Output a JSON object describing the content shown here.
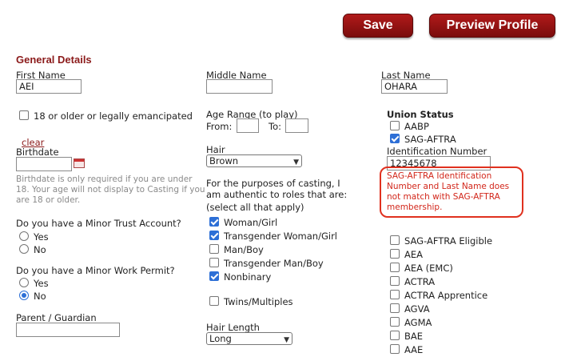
{
  "toolbar": {
    "save_label": "Save",
    "preview_label": "Preview Profile"
  },
  "section_title": "General Details",
  "first_name": {
    "label": "First Name",
    "value": "AEI"
  },
  "middle_name": {
    "label": "Middle Name",
    "value": ""
  },
  "last_name": {
    "label": "Last Name",
    "value": "OHARA"
  },
  "emancipated": {
    "label": "18 or older or legally emancipated",
    "checked": false
  },
  "clear_link": "clear",
  "birthdate": {
    "label": "Birthdate",
    "value": "",
    "note": [
      "Birthdate is only required if you are under",
      "18. Your age will not display to Casting if you",
      "are 18 or older."
    ]
  },
  "age_range": {
    "label": "Age Range (to play)",
    "from_label": "From:",
    "to_label": "To:",
    "from_value": "",
    "to_value": ""
  },
  "hair": {
    "label": "Hair",
    "value": "Brown"
  },
  "casting": {
    "prompt": [
      "For the purposes of casting, I",
      "am authentic to roles that are:"
    ],
    "hint": "(select all that apply)",
    "options": [
      {
        "label": "Woman/Girl",
        "checked": true
      },
      {
        "label": "Transgender Woman/Girl",
        "checked": true
      },
      {
        "label": "Man/Boy",
        "checked": false
      },
      {
        "label": "Transgender Man/Boy",
        "checked": false
      },
      {
        "label": "Nonbinary",
        "checked": true
      }
    ],
    "twins": {
      "label": "Twins/Multiples",
      "checked": false
    }
  },
  "hair_length": {
    "label": "Hair Length",
    "value": "Long"
  },
  "minor_trust": {
    "question": "Do you have a Minor Trust Account?",
    "yes": "Yes",
    "no": "No",
    "selected": "none"
  },
  "minor_permit": {
    "question": "Do you have a Minor Work Permit?",
    "yes": "Yes",
    "no": "No",
    "selected": "No"
  },
  "guardian": {
    "label": "Parent / Guardian",
    "value": ""
  },
  "union": {
    "title": "Union Status",
    "aabp": {
      "label": "AABP",
      "checked": false
    },
    "sag": {
      "label": "SAG-AFTRA",
      "checked": true
    },
    "id_label": "Identification Number",
    "id_value": "12345678",
    "error": [
      "SAG-AFTRA Identification",
      "Number and Last Name does",
      "not match with SAG-AFTRA",
      "membership."
    ],
    "others": [
      {
        "label": "SAG-AFTRA Eligible",
        "checked": false
      },
      {
        "label": "AEA",
        "checked": false
      },
      {
        "label": "AEA (EMC)",
        "checked": false
      },
      {
        "label": "ACTRA",
        "checked": false
      },
      {
        "label": "ACTRA Apprentice",
        "checked": false
      },
      {
        "label": "AGVA",
        "checked": false
      },
      {
        "label": "AGMA",
        "checked": false
      },
      {
        "label": "BAE",
        "checked": false
      },
      {
        "label": "AAE",
        "checked": false
      }
    ]
  },
  "colors": {
    "accent": "#8b1a1a",
    "button": "#9b1414",
    "error": "#e0311f",
    "check": "#2d6fd6"
  }
}
